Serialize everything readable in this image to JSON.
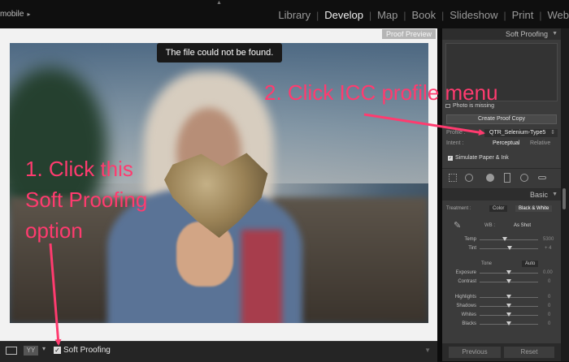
{
  "topbar": {
    "identity": "mobile",
    "modules": [
      {
        "label": "Library",
        "active": false
      },
      {
        "label": "Develop",
        "active": true
      },
      {
        "label": "Map",
        "active": false
      },
      {
        "label": "Book",
        "active": false
      },
      {
        "label": "Slideshow",
        "active": false
      },
      {
        "label": "Print",
        "active": false
      },
      {
        "label": "Web",
        "active": false
      }
    ]
  },
  "main": {
    "proof_badge": "Proof Preview",
    "toast": "The file could not be found."
  },
  "toolbar": {
    "yy_label": "YY",
    "soft_proofing_label": "Soft Proofing",
    "soft_proofing_checked": true
  },
  "panel": {
    "soft_proofing_header": "Soft Proofing",
    "photo_missing": "Photo is missing",
    "create_proof_copy": "Create Proof Copy",
    "profile_label": "Profile :",
    "profile_value": "QTR_Selenium-Type5",
    "intent_label": "Intent :",
    "intent_perceptual": "Perceptual",
    "intent_relative": "Relative",
    "simulate_label": "Simulate Paper & Ink",
    "basic_header": "Basic",
    "treatment_label": "Treatment :",
    "treatment_color": "Color",
    "treatment_bw": "Black & White",
    "wb_label": "WB :",
    "wb_value": "As Shot",
    "temp_label": "Temp",
    "temp_value": "5300",
    "tint_label": "Tint",
    "tint_value": "+ 4",
    "tone_label": "Tone",
    "auto_label": "Auto",
    "exposure_label": "Exposure",
    "exposure_value": "0.00",
    "contrast_label": "Contrast",
    "contrast_value": "0",
    "highlights_label": "Highlights",
    "shadows_label": "Shadows",
    "whites_label": "Whites",
    "blacks_label": "Blacks",
    "zero": "0",
    "previous": "Previous",
    "reset": "Reset"
  },
  "annotations": {
    "step2": "2. Click ICC profile menu",
    "step1_line1": "1. Click this",
    "step1_line2": "Soft Proofing",
    "step1_line3": "option"
  },
  "colors": {
    "annotation": "#ff3b6f",
    "app_dark": "#111111",
    "panel": "#3b3b3b"
  }
}
